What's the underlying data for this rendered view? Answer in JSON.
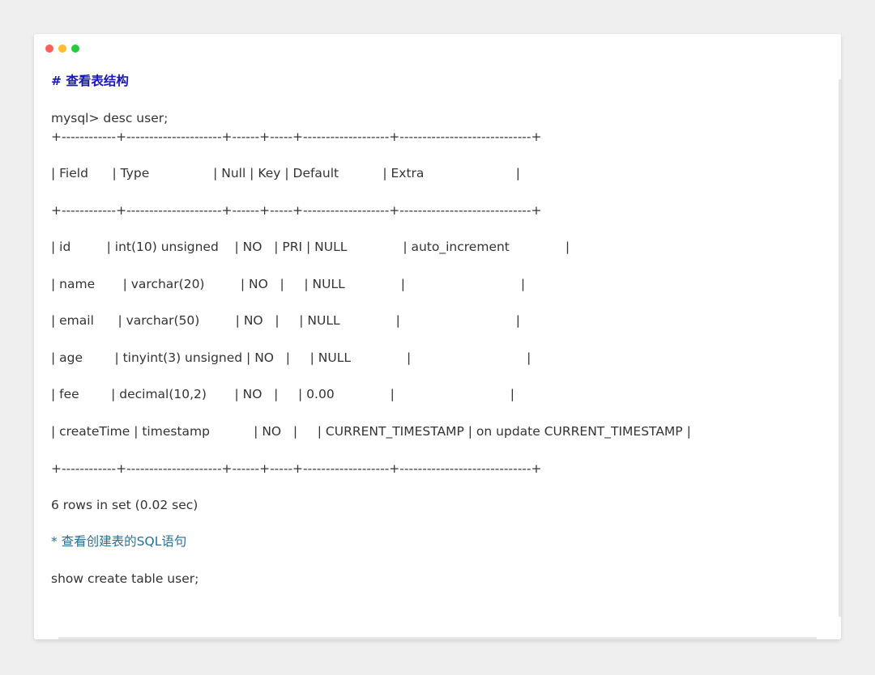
{
  "window": {
    "dots": [
      "close",
      "minimize",
      "maximize"
    ],
    "colors": {
      "close": "#ff5f56",
      "minimize": "#ffbd2e",
      "maximize": "#27c93f",
      "heading": "#1818b8",
      "comment": "#2a6f93",
      "text": "#333333"
    }
  },
  "code": {
    "heading": "# 查看表结构",
    "prompt": "mysql> desc user;",
    "border_top": "+------------+---------------------+------+-----+-------------------+-----------------------------+",
    "header_row": "| Field      | Type                | Null | Key | Default           | Extra                       |",
    "border_mid": "+------------+---------------------+------+-----+-------------------+-----------------------------+",
    "rows": [
      "| id         | int(10) unsigned    | NO   | PRI | NULL              | auto_increment              |",
      "| name       | varchar(20)         | NO   |     | NULL              |                             |",
      "| email      | varchar(50)         | NO   |     | NULL              |                             |",
      "| age        | tinyint(3) unsigned | NO   |     | NULL              |                             |",
      "| fee        | decimal(10,2)       | NO   |     | 0.00              |                             |",
      "| createTime | timestamp           | NO   |     | CURRENT_TIMESTAMP | on update CURRENT_TIMESTAMP |"
    ],
    "border_bottom": "+------------+---------------------+------+-----+-------------------+-----------------------------+",
    "result": "6 rows in set (0.02 sec)",
    "comment": "* 查看创建表的SQL语句",
    "statement": "show create table user;"
  }
}
